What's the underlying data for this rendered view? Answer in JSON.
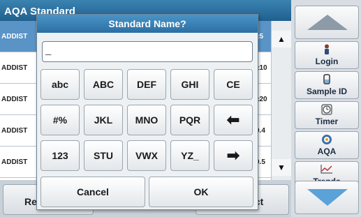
{
  "background": {
    "title": "AQA Standard",
    "rows": [
      {
        "name": "ADDIST",
        "value": "±5"
      },
      {
        "name": "ADDIST",
        "value": "±10"
      },
      {
        "name": "ADDIST",
        "value": "±20"
      },
      {
        "name": "ADDIST",
        "value": "0.4"
      },
      {
        "name": "ADDIST",
        "value": "0.5"
      }
    ],
    "bottom_buttons": {
      "back": "Re",
      "select": "ect"
    }
  },
  "sidepanel": {
    "login": "Login",
    "sample_id": "Sample ID",
    "timer": "Timer",
    "aqa": "AQA",
    "trends": "Trends"
  },
  "dialog": {
    "title": "Standard Name?",
    "input_value": "_",
    "keys": [
      [
        "abc",
        "ABC",
        "DEF",
        "GHI",
        "CE"
      ],
      [
        "#%",
        "JKL",
        "MNO",
        "PQR",
        "⬅"
      ],
      [
        "123",
        "STU",
        "VWX",
        "YZ_",
        "➡"
      ]
    ],
    "cancel": "Cancel",
    "ok": "OK"
  },
  "colors": {
    "accent": "#2a6fa3",
    "selected_row": "#5a93c6",
    "scroll_down_arrow": "#5aa2d8"
  }
}
